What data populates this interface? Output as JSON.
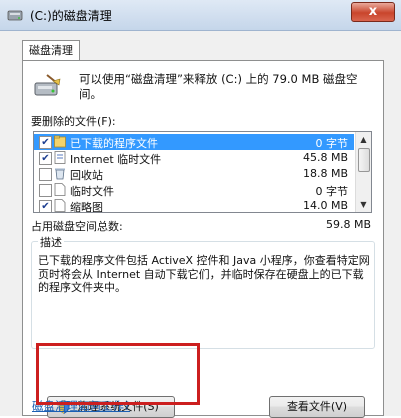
{
  "window": {
    "title": "(C:)的磁盘清理",
    "close_label": "x"
  },
  "tab": {
    "label": "磁盘清理"
  },
  "intro": "可以使用“磁盘清理”来释放 (C:) 上的 79.0 MB 磁盘空间。",
  "list": {
    "label": "要删除的文件(F):",
    "items": [
      {
        "name": "已下载的程序文件",
        "size": "0 字节",
        "checked": true,
        "selected": true,
        "icon": "folder-icon"
      },
      {
        "name": "Internet 临时文件",
        "size": "45.8 MB",
        "checked": true,
        "selected": false,
        "icon": "page-icon"
      },
      {
        "name": "回收站",
        "size": "18.8 MB",
        "checked": false,
        "selected": false,
        "icon": "recycle-bin-icon"
      },
      {
        "name": "临时文件",
        "size": "0 字节",
        "checked": false,
        "selected": false,
        "icon": "file-icon"
      },
      {
        "name": "缩略图",
        "size": "14.0 MB",
        "checked": true,
        "selected": false,
        "icon": "file-icon"
      }
    ]
  },
  "total": {
    "label": "占用磁盘空间总数:",
    "value": "59.8 MB"
  },
  "description": {
    "title": "描述",
    "text": "已下载的程序文件包括 ActiveX 控件和 Java 小程序，你查看特定网页时将会从 Internet 自动下载它们，并临时保存在硬盘上的已下载的程序文件夹中。"
  },
  "buttons": {
    "clean_system": "清理系统文件(S)",
    "view_files": "查看文件(V)"
  },
  "help_link": "磁盘清理如何工作?",
  "colors": {
    "selection": "#3399ff",
    "highlight": "#cc1f1f",
    "link": "#1a5fb4"
  }
}
